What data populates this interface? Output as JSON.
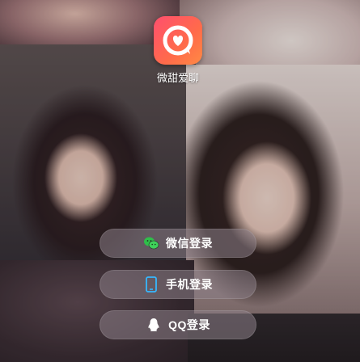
{
  "app": {
    "name": "微甜爱聊",
    "logo_icon": "heart-chat-bubble-icon",
    "logo_color": "#ff5a6a"
  },
  "login_options": [
    {
      "id": "wechat",
      "label": "微信登录",
      "icon": "wechat-icon",
      "icon_color": "#2fbf4a"
    },
    {
      "id": "phone",
      "label": "手机登录",
      "icon": "phone-icon",
      "icon_color": "#36b8ff"
    },
    {
      "id": "qq",
      "label": "QQ登录",
      "icon": "qq-icon",
      "icon_color": "#ffffff"
    }
  ]
}
